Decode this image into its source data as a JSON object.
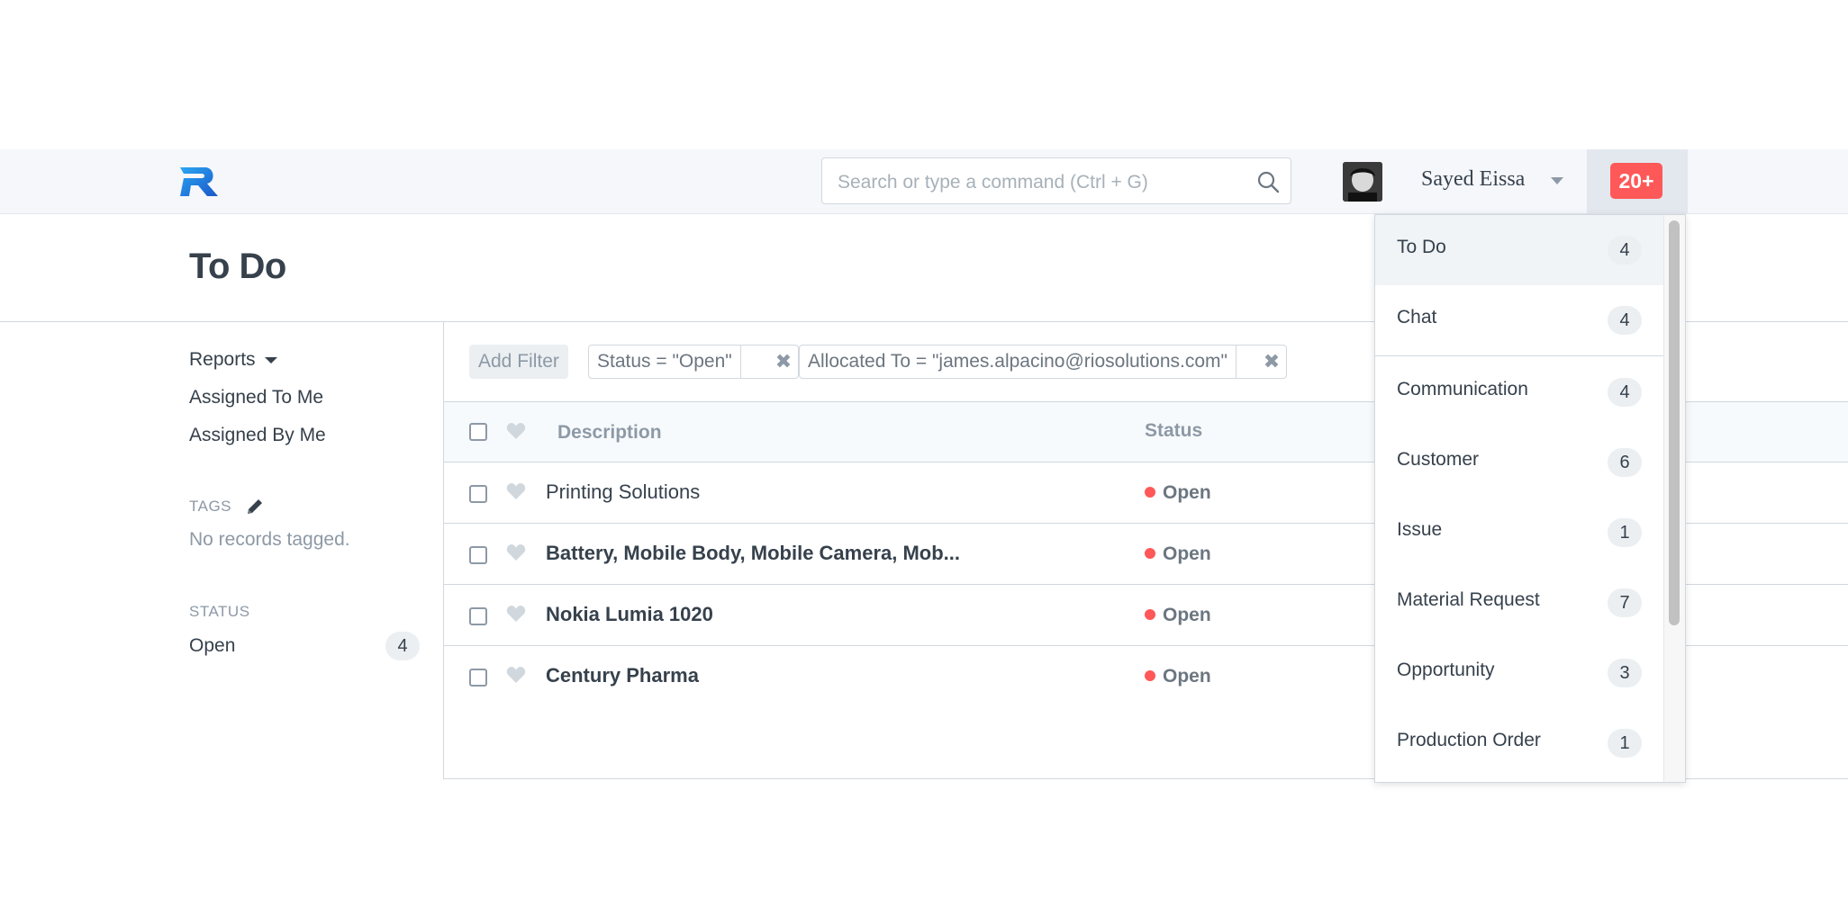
{
  "navbar": {
    "search_placeholder": "Search or type a command (Ctrl + G)",
    "user_name": "Sayed Eissa",
    "notification_badge": "20+",
    "icons": {
      "logo": "r-logo",
      "search": "search-icon",
      "user_caret": "caret-down-icon"
    }
  },
  "page": {
    "title": "To Do"
  },
  "sidebar": {
    "reports_label": "Reports",
    "assigned_to_me": "Assigned To Me",
    "assigned_by_me": "Assigned By Me",
    "tags_heading": "TAGS",
    "no_tags": "No records tagged.",
    "status_heading": "STATUS",
    "status_items": [
      {
        "label": "Open",
        "count": "4"
      }
    ]
  },
  "filters": {
    "add_filter_label": "Add Filter",
    "active": [
      {
        "text": "Status = \"Open\"",
        "remove": "✖"
      },
      {
        "text": "Allocated To = \"james.alpacino@riosolutions.com\"",
        "remove": "✖"
      }
    ]
  },
  "table": {
    "columns": {
      "description": "Description",
      "status": "Status"
    },
    "rows": [
      {
        "title": "Printing Solutions",
        "status": "Open",
        "bold": false
      },
      {
        "title": "Battery, Mobile Body, Mobile Camera, Mob...",
        "status": "Open",
        "bold": true
      },
      {
        "title": "Nokia Lumia 1020",
        "status": "Open",
        "bold": true
      },
      {
        "title": "Century Pharma",
        "status": "Open",
        "bold": true
      }
    ]
  },
  "notifications_dropdown": {
    "items": [
      {
        "label": "To Do",
        "count": "4"
      },
      {
        "label": "Chat",
        "count": "4"
      },
      {
        "label": "Communication",
        "count": "4"
      },
      {
        "label": "Customer",
        "count": "6"
      },
      {
        "label": "Issue",
        "count": "1"
      },
      {
        "label": "Material Request",
        "count": "7"
      },
      {
        "label": "Opportunity",
        "count": "3"
      },
      {
        "label": "Production Order",
        "count": "1"
      }
    ]
  },
  "colors": {
    "accent_red": "#ff5858",
    "navbar_bg": "#f5f7fa",
    "text_dark": "#36414c",
    "text_muted": "#8d99a6"
  }
}
